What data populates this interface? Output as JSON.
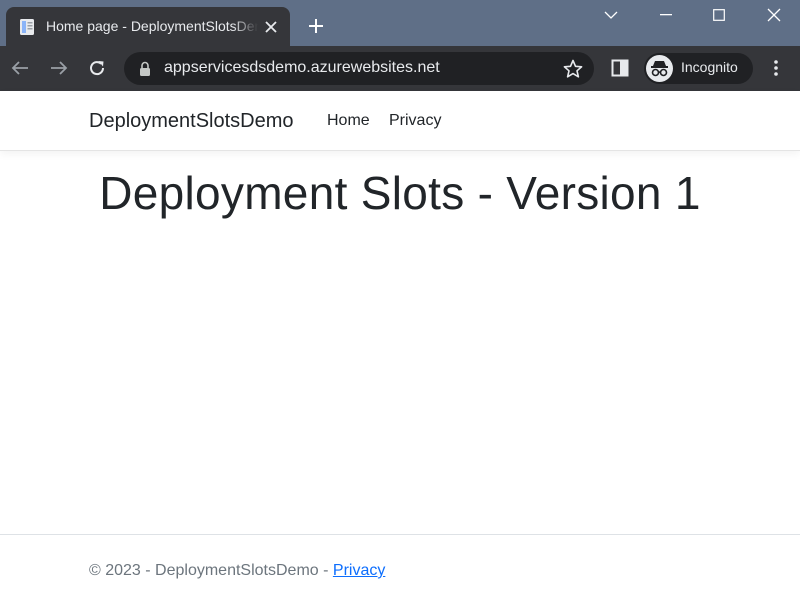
{
  "browser": {
    "tab": {
      "title": "Home page - DeploymentSlotsDemo",
      "favicon": "page-icon"
    },
    "address_bar": {
      "url": "appservicesdsdemo.azurewebsites.net"
    },
    "profile": {
      "label": "Incognito",
      "icon": "incognito-icon"
    }
  },
  "page": {
    "navbar": {
      "brand": "DeploymentSlotsDemo",
      "links": [
        "Home",
        "Privacy"
      ]
    },
    "heading": "Deployment Slots - Version 1",
    "footer": {
      "text": "© 2023 - DeploymentSlotsDemo - ",
      "link": "Privacy"
    }
  },
  "colors": {
    "titlebar": "#5f6f87",
    "toolbar": "#35363a",
    "omnibox": "#202124",
    "link": "#0d6efd"
  }
}
